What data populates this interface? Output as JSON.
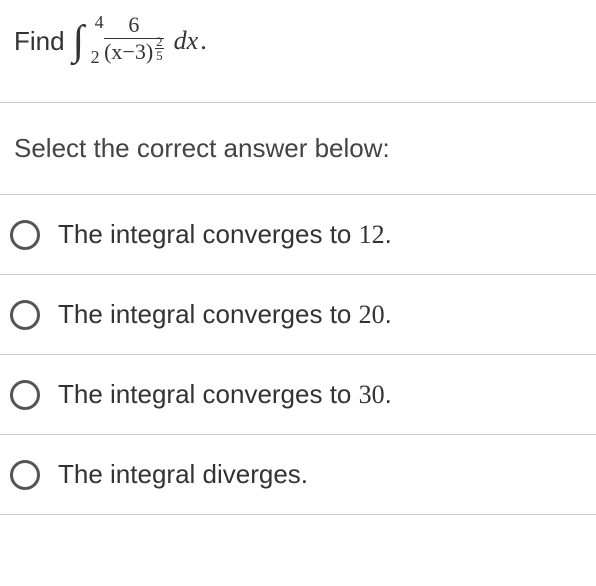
{
  "question": {
    "prefix": "Find",
    "integral_symbol": "∫",
    "lower_bound": "2",
    "upper_bound": "4",
    "numerator": "6",
    "denominator_base": "(x−3)",
    "denominator_exp_top": "2",
    "denominator_exp_bot": "5",
    "dx": "dx",
    "period": "."
  },
  "instruction": "Select the correct answer below:",
  "options": [
    {
      "prefix": "The integral converges to ",
      "value": "12",
      "suffix": "."
    },
    {
      "prefix": "The integral converges to ",
      "value": "20",
      "suffix": "."
    },
    {
      "prefix": "The integral converges to ",
      "value": "30",
      "suffix": "."
    },
    {
      "prefix": "The integral diverges.",
      "value": "",
      "suffix": ""
    }
  ]
}
